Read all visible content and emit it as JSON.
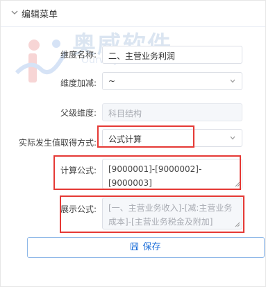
{
  "panel": {
    "title": "编辑菜单"
  },
  "watermark": {
    "text_cn": "奥威软件",
    "text_en": "Ourway Power"
  },
  "form": {
    "dimension_name": {
      "label": "维度名称:",
      "value": "二、主营业务利润"
    },
    "dimension_add_sub": {
      "label": "维度加减:",
      "value": "~"
    },
    "parent_dimension": {
      "label": "父级维度:",
      "value": "科目结构"
    },
    "actual_value_method": {
      "label": "实际发生值取得方式:",
      "value": "公式计算"
    },
    "calc_formula": {
      "label": "计算公式:",
      "value": "[9000001]-[9000002]-[9000003]"
    },
    "display_formula": {
      "label": "展示公式:",
      "value": "[一、主营业务收入]-[减:主营业务成本]-[主营业务税金及附加]"
    }
  },
  "actions": {
    "save_label": "保存"
  },
  "colors": {
    "highlight": "#e53935",
    "primary": "#1e6fd9"
  }
}
